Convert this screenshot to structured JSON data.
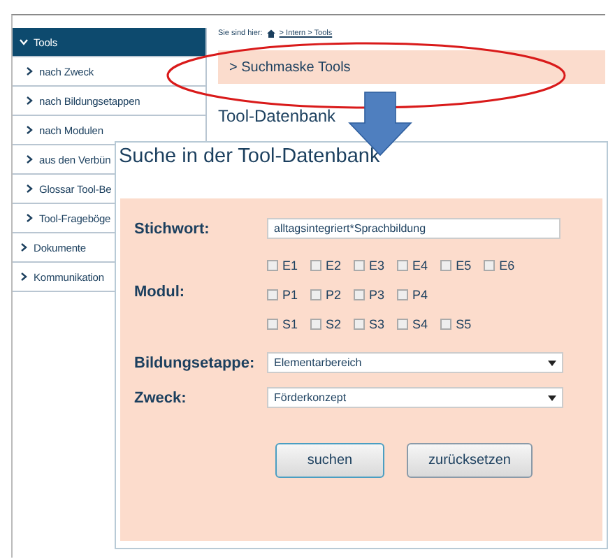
{
  "sidebar": {
    "items": [
      {
        "label": "Tools",
        "selected": true,
        "expanded": true,
        "children": [
          {
            "label": "nach Zweck",
            "selected": false
          },
          {
            "label": "nach Bildungsetappen",
            "selected": false
          },
          {
            "label": "nach Modulen",
            "selected": false
          },
          {
            "label": "aus den Verbün",
            "selected": false
          },
          {
            "label": "Glossar Tool-Be",
            "selected": false
          },
          {
            "label": "Tool-Frageböge",
            "selected": false
          }
        ]
      },
      {
        "label": "Dokumente",
        "selected": false,
        "expanded": false
      },
      {
        "label": "Kommunikation",
        "selected": false,
        "expanded": false
      }
    ]
  },
  "breadcrumb": {
    "prefix": "Sie sind hier:",
    "trail": "> Intern > Tools"
  },
  "highlight_bar": {
    "label": "> Suchmaske Tools"
  },
  "heading": "Tool-Datenbank",
  "dialog": {
    "title": "Suche in der Tool-Datenbank",
    "keyword": {
      "label": "Stichwort:",
      "value": "alltagsintegriert*Sprachbildung"
    },
    "modules": {
      "label": "Modul:",
      "rows": [
        [
          {
            "label": "E1",
            "checked": false
          },
          {
            "label": "E2",
            "checked": false
          },
          {
            "label": "E3",
            "checked": false
          },
          {
            "label": "E4",
            "checked": false
          },
          {
            "label": "E5",
            "checked": false
          },
          {
            "label": "E6",
            "checked": false
          }
        ],
        [
          {
            "label": "P1",
            "checked": false
          },
          {
            "label": "P2",
            "checked": false
          },
          {
            "label": "P3",
            "checked": false
          },
          {
            "label": "P4",
            "checked": false
          }
        ],
        [
          {
            "label": "S1",
            "checked": false
          },
          {
            "label": "S2",
            "checked": false
          },
          {
            "label": "S3",
            "checked": false
          },
          {
            "label": "S4",
            "checked": false
          },
          {
            "label": "S5",
            "checked": false
          }
        ]
      ]
    },
    "selects": [
      {
        "label": "Bildungsetappe:",
        "value": "Elementarbereich"
      },
      {
        "label": "Zweck:",
        "value": "Förderkonzept"
      }
    ],
    "buttons": [
      {
        "label": "suchen",
        "kind": "primary"
      },
      {
        "label": "zurücksetzen",
        "kind": "secondary"
      }
    ]
  }
}
